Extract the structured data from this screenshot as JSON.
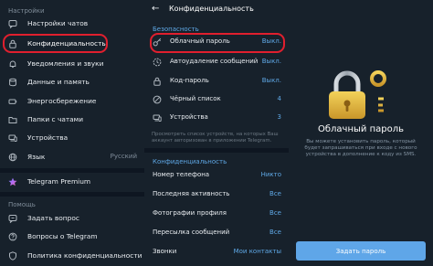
{
  "sidebar": {
    "section_settings": "Настройки",
    "items": [
      {
        "label": "Настройки чатов",
        "icon": "chat-settings-icon"
      },
      {
        "label": "Конфиденциальность",
        "icon": "lock-icon"
      },
      {
        "label": "Уведомления и звуки",
        "icon": "bell-icon"
      },
      {
        "label": "Данные и память",
        "icon": "storage-icon"
      },
      {
        "label": "Энергосбережение",
        "icon": "battery-icon"
      },
      {
        "label": "Папки с чатами",
        "icon": "folder-icon"
      },
      {
        "label": "Устройства",
        "icon": "devices-icon"
      },
      {
        "label": "Язык",
        "icon": "language-icon",
        "value": "Русский"
      }
    ],
    "premium_label": "Telegram Premium",
    "section_help": "Помощь",
    "help_items": [
      {
        "label": "Задать вопрос",
        "icon": "question-chat-icon"
      },
      {
        "label": "Вопросы о Telegram",
        "icon": "help-icon"
      },
      {
        "label": "Политика конфиденциальности",
        "icon": "shield-icon"
      }
    ]
  },
  "privacy": {
    "title": "Конфиденциальность",
    "section_security": "Безопасность",
    "security_rows": [
      {
        "label": "Облачный пароль",
        "value": "Выкл.",
        "icon": "key-icon"
      },
      {
        "label": "Автоудаление сообщений",
        "value": "Выкл.",
        "icon": "timer-icon"
      },
      {
        "label": "Код-пароль",
        "value": "Выкл.",
        "icon": "lock-icon"
      },
      {
        "label": "Чёрный список",
        "value": "4",
        "icon": "block-icon"
      },
      {
        "label": "Устройства",
        "value": "3",
        "icon": "devices-icon"
      }
    ],
    "devices_note": "Просмотреть список устройств, на которых Ваш аккаунт авторизован в приложении Telegram.",
    "section_privacy": "Конфиденциальность",
    "privacy_rows": [
      {
        "label": "Номер телефона",
        "value": "Никто"
      },
      {
        "label": "Последняя активность",
        "value": "Все"
      },
      {
        "label": "Фотографии профиля",
        "value": "Все"
      },
      {
        "label": "Пересылка сообщений",
        "value": "Все"
      },
      {
        "label": "Звонки",
        "value": "Мои контакты"
      }
    ]
  },
  "cloud_password": {
    "title": "Облачный пароль",
    "description": "Вы можете установить пароль, который будет запрашиваться при входе с нового устройства в дополнение к коду из SMS.",
    "button_label": "Задать пароль"
  },
  "colors": {
    "accent": "#5fa6e8",
    "highlight_ring": "#e01f2e",
    "background": "#17212b",
    "separator": "#0e1621"
  }
}
